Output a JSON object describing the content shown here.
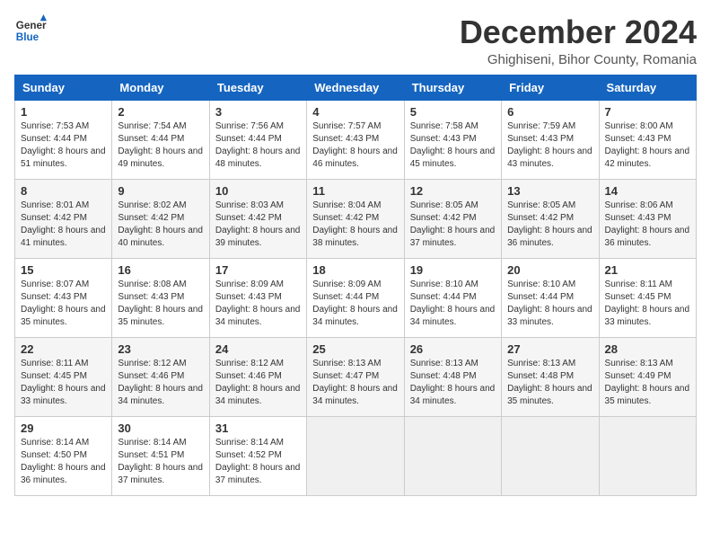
{
  "logo": {
    "line1": "General",
    "line2": "Blue"
  },
  "title": "December 2024",
  "subtitle": "Ghighiseni, Bihor County, Romania",
  "columns": [
    "Sunday",
    "Monday",
    "Tuesday",
    "Wednesday",
    "Thursday",
    "Friday",
    "Saturday"
  ],
  "weeks": [
    [
      {
        "day": "1",
        "sunrise": "7:53 AM",
        "sunset": "4:44 PM",
        "daylight": "8 hours and 51 minutes."
      },
      {
        "day": "2",
        "sunrise": "7:54 AM",
        "sunset": "4:44 PM",
        "daylight": "8 hours and 49 minutes."
      },
      {
        "day": "3",
        "sunrise": "7:56 AM",
        "sunset": "4:44 PM",
        "daylight": "8 hours and 48 minutes."
      },
      {
        "day": "4",
        "sunrise": "7:57 AM",
        "sunset": "4:43 PM",
        "daylight": "8 hours and 46 minutes."
      },
      {
        "day": "5",
        "sunrise": "7:58 AM",
        "sunset": "4:43 PM",
        "daylight": "8 hours and 45 minutes."
      },
      {
        "day": "6",
        "sunrise": "7:59 AM",
        "sunset": "4:43 PM",
        "daylight": "8 hours and 43 minutes."
      },
      {
        "day": "7",
        "sunrise": "8:00 AM",
        "sunset": "4:43 PM",
        "daylight": "8 hours and 42 minutes."
      }
    ],
    [
      {
        "day": "8",
        "sunrise": "8:01 AM",
        "sunset": "4:42 PM",
        "daylight": "8 hours and 41 minutes."
      },
      {
        "day": "9",
        "sunrise": "8:02 AM",
        "sunset": "4:42 PM",
        "daylight": "8 hours and 40 minutes."
      },
      {
        "day": "10",
        "sunrise": "8:03 AM",
        "sunset": "4:42 PM",
        "daylight": "8 hours and 39 minutes."
      },
      {
        "day": "11",
        "sunrise": "8:04 AM",
        "sunset": "4:42 PM",
        "daylight": "8 hours and 38 minutes."
      },
      {
        "day": "12",
        "sunrise": "8:05 AM",
        "sunset": "4:42 PM",
        "daylight": "8 hours and 37 minutes."
      },
      {
        "day": "13",
        "sunrise": "8:05 AM",
        "sunset": "4:42 PM",
        "daylight": "8 hours and 36 minutes."
      },
      {
        "day": "14",
        "sunrise": "8:06 AM",
        "sunset": "4:43 PM",
        "daylight": "8 hours and 36 minutes."
      }
    ],
    [
      {
        "day": "15",
        "sunrise": "8:07 AM",
        "sunset": "4:43 PM",
        "daylight": "8 hours and 35 minutes."
      },
      {
        "day": "16",
        "sunrise": "8:08 AM",
        "sunset": "4:43 PM",
        "daylight": "8 hours and 35 minutes."
      },
      {
        "day": "17",
        "sunrise": "8:09 AM",
        "sunset": "4:43 PM",
        "daylight": "8 hours and 34 minutes."
      },
      {
        "day": "18",
        "sunrise": "8:09 AM",
        "sunset": "4:44 PM",
        "daylight": "8 hours and 34 minutes."
      },
      {
        "day": "19",
        "sunrise": "8:10 AM",
        "sunset": "4:44 PM",
        "daylight": "8 hours and 34 minutes."
      },
      {
        "day": "20",
        "sunrise": "8:10 AM",
        "sunset": "4:44 PM",
        "daylight": "8 hours and 33 minutes."
      },
      {
        "day": "21",
        "sunrise": "8:11 AM",
        "sunset": "4:45 PM",
        "daylight": "8 hours and 33 minutes."
      }
    ],
    [
      {
        "day": "22",
        "sunrise": "8:11 AM",
        "sunset": "4:45 PM",
        "daylight": "8 hours and 33 minutes."
      },
      {
        "day": "23",
        "sunrise": "8:12 AM",
        "sunset": "4:46 PM",
        "daylight": "8 hours and 34 minutes."
      },
      {
        "day": "24",
        "sunrise": "8:12 AM",
        "sunset": "4:46 PM",
        "daylight": "8 hours and 34 minutes."
      },
      {
        "day": "25",
        "sunrise": "8:13 AM",
        "sunset": "4:47 PM",
        "daylight": "8 hours and 34 minutes."
      },
      {
        "day": "26",
        "sunrise": "8:13 AM",
        "sunset": "4:48 PM",
        "daylight": "8 hours and 34 minutes."
      },
      {
        "day": "27",
        "sunrise": "8:13 AM",
        "sunset": "4:48 PM",
        "daylight": "8 hours and 35 minutes."
      },
      {
        "day": "28",
        "sunrise": "8:13 AM",
        "sunset": "4:49 PM",
        "daylight": "8 hours and 35 minutes."
      }
    ],
    [
      {
        "day": "29",
        "sunrise": "8:14 AM",
        "sunset": "4:50 PM",
        "daylight": "8 hours and 36 minutes."
      },
      {
        "day": "30",
        "sunrise": "8:14 AM",
        "sunset": "4:51 PM",
        "daylight": "8 hours and 37 minutes."
      },
      {
        "day": "31",
        "sunrise": "8:14 AM",
        "sunset": "4:52 PM",
        "daylight": "8 hours and 37 minutes."
      },
      null,
      null,
      null,
      null
    ]
  ]
}
